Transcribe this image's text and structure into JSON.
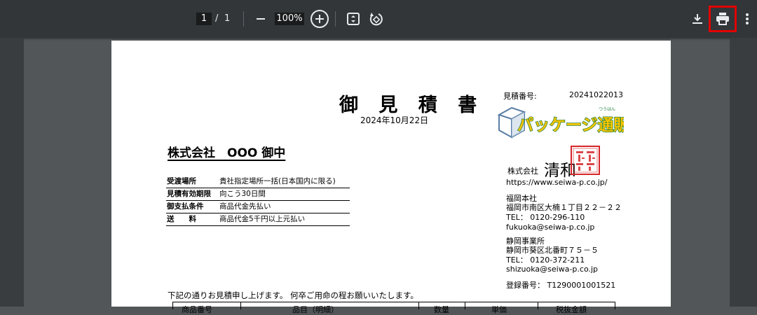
{
  "toolbar": {
    "page_current": "1",
    "page_sep": "/",
    "page_total": "1",
    "zoom": "100%",
    "icons": [
      "minus-icon",
      "plus-circle-icon",
      "fit-page-icon",
      "rotate-icon",
      "download-icon",
      "print-icon",
      "more-vert-icon"
    ]
  },
  "doc": {
    "title": "御 見 積 書",
    "date": "2024年10月22日",
    "est_label": "見積番号:",
    "est_no": "20241022013",
    "client": "株式会社　OOO 御中",
    "terms": [
      {
        "label": "受渡場所",
        "value": "貴社指定場所一括(日本国内に限る)"
      },
      {
        "label": "見積有効期限",
        "value": "向こう30日間"
      },
      {
        "label": "御支払条件",
        "value": "商品代金先払い"
      },
      {
        "label": "送　　料",
        "value": "商品代金5千円以上元払い"
      }
    ],
    "logo_text": "パッケージ通販",
    "logo_ruby": "つうはん",
    "company_prefix": "株式会社",
    "company_name": "清和",
    "url": "https://www.seiwa-p.co.jp/",
    "fukuoka": {
      "name": "福岡本社",
      "address": "福岡市南区大楠１丁目２２－２２",
      "tel": "TEL：  0120-296-110",
      "email": "fukuoka@seiwa-p.co.jp"
    },
    "shizuoka": {
      "name": "静岡事業所",
      "address": "静岡市葵区北番町７５－５",
      "tel": "TEL：  0120-372-211",
      "email": "shizuoka@seiwa-p.co.jp"
    },
    "registration": "登録番号：  T1290001001521",
    "intro": "下記の通りお見積申し上げます。 何卒ご用命の程お願いいたします。",
    "table_headers": [
      "商品番号",
      "品目（明細）",
      "数量",
      "単価",
      "税抜金額"
    ]
  },
  "colors": {
    "toolbar_bg": "#323639",
    "viewer_bg": "#525659",
    "highlight": "#e10000",
    "logo_yellow": "#f5c400",
    "seal_red": "#d6262a"
  }
}
